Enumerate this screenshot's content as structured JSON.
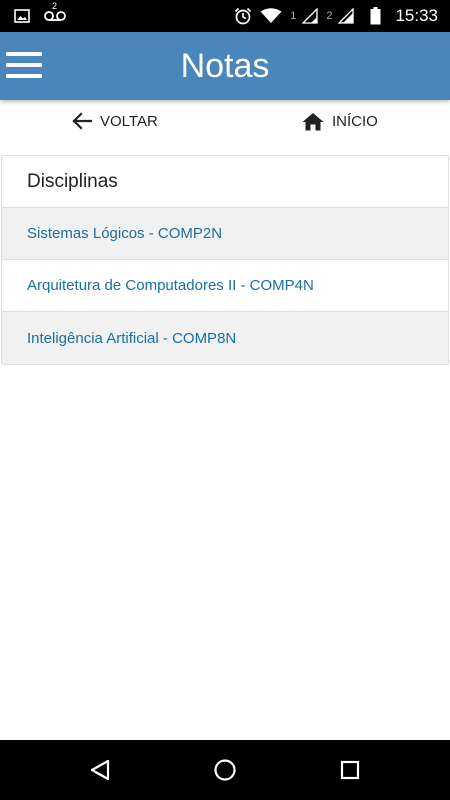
{
  "status_bar": {
    "icons": [
      "image-icon",
      "voicemail-icon",
      "alarm-icon",
      "wifi-icon",
      "signal-icon",
      "signal-icon",
      "battery-icon"
    ],
    "voicemail_count": "2",
    "sim1": "1",
    "sim2": "2",
    "time": "15:33"
  },
  "app_bar": {
    "title": "Notas",
    "color": "#4a86bb",
    "menu_icon": "hamburger-menu-icon"
  },
  "nav": {
    "back_label": "VOLTAR",
    "back_icon": "arrow-left-icon",
    "home_label": "INÍCIO",
    "home_icon": "home-icon"
  },
  "panel": {
    "heading": "Disciplinas",
    "items": [
      {
        "label": "Sistemas Lógicos - COMP2N"
      },
      {
        "label": "Arquitetura de Computadores II - COMP4N"
      },
      {
        "label": "Inteligência Artificial - COMP8N"
      }
    ],
    "link_color": "#1a6fa3"
  },
  "system_nav": {
    "icons": [
      "back-triangle-icon",
      "home-circle-icon",
      "recents-square-icon"
    ]
  }
}
